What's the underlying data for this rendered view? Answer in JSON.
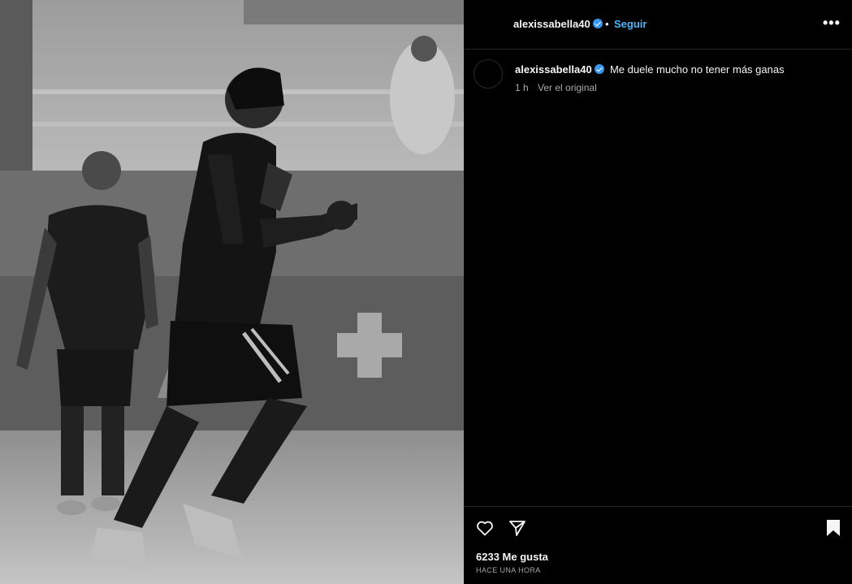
{
  "post": {
    "username": "alexissabella40",
    "separator": "•",
    "follow_label": "Seguir",
    "more_label": "•••",
    "caption_text": "Me duele mucho no tener más ganas",
    "time_short": "1 h",
    "see_original": "Ver el original",
    "likes": "6233 Me gusta",
    "time_long": "HACE UNA HORA"
  },
  "icons": {
    "verified": "verified-badge-icon",
    "like": "heart-icon",
    "share": "send-icon",
    "save": "bookmark-icon",
    "more": "more-options-icon"
  },
  "colors": {
    "background": "#000000",
    "follow_link": "#4cb5f9",
    "verified_badge": "#3897f0",
    "muted_text": "#a8a8a8"
  }
}
